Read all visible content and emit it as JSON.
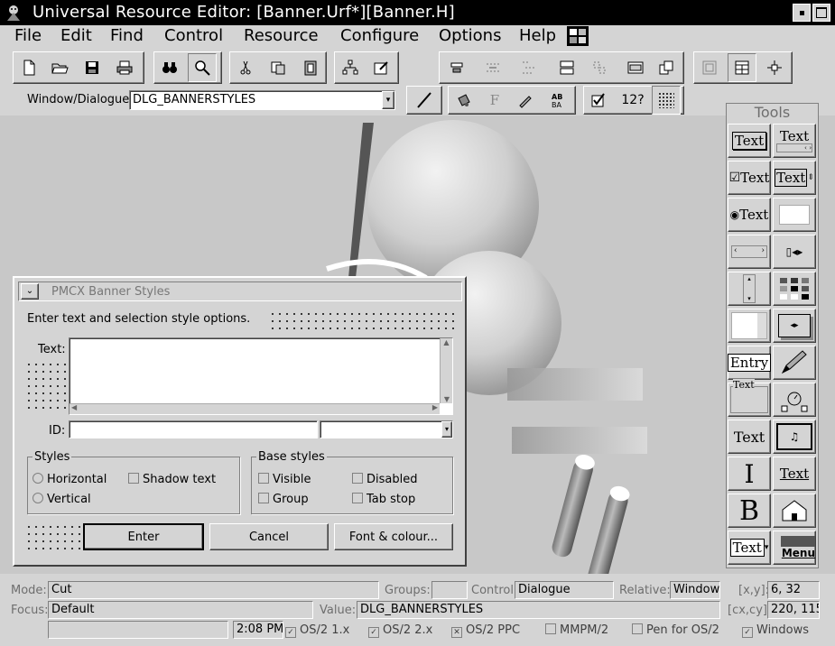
{
  "window": {
    "title": "Universal Resource Editor: [Banner.Urf*][Banner.H]"
  },
  "menu": {
    "items": [
      "File",
      "Edit",
      "Find",
      "Control",
      "Resource",
      "Configure",
      "Options",
      "Help"
    ]
  },
  "toolbar": {
    "window_label": "Window/Dialogue:",
    "window_value": "DLG_BANNERSTYLES",
    "help_label": "12?"
  },
  "tools": {
    "title": "Tools",
    "items": [
      "Text",
      "Text",
      "Text",
      "Text",
      "Text",
      "Entry",
      "Text",
      "Text",
      "Text",
      "Text",
      "Text",
      "Menu"
    ]
  },
  "dialog": {
    "title": "PMCX Banner Styles",
    "instruction": "Enter text and selection style options.",
    "text_label": "Text:",
    "id_label": "ID:",
    "styles_group": "Styles",
    "styles": [
      "Horizontal",
      "Vertical",
      "Shadow text"
    ],
    "base_group": "Base styles",
    "base_styles": [
      "Visible",
      "Disabled",
      "Group",
      "Tab stop"
    ],
    "buttons": [
      "Enter",
      "Cancel",
      "Font & colour..."
    ]
  },
  "status": {
    "mode_label": "Mode:",
    "mode_value": "Cut",
    "groups_label": "Groups:",
    "groups_value": "",
    "control_label": "Control:",
    "control_value": "Dialogue",
    "relative_label": "Relative:",
    "relative_value": "Window",
    "xy_label": "[x,y]:",
    "xy_value": "6, 32",
    "focus_label": "Focus:",
    "focus_value": "Default",
    "value_label": "Value:",
    "value_value": "DLG_BANNERSTYLES",
    "cxcy_label": "[cx,cy]:",
    "cxcy_value": "220, 115",
    "time": "2:08 PM",
    "options": [
      {
        "label": "OS/2 1.x",
        "checked": true
      },
      {
        "label": "OS/2 2.x",
        "checked": true
      },
      {
        "label": "OS/2 PPC",
        "checked": true
      },
      {
        "label": "MMPM/2",
        "checked": false
      },
      {
        "label": "Pen for OS/2",
        "checked": false
      },
      {
        "label": "Windows",
        "checked": true
      }
    ]
  }
}
